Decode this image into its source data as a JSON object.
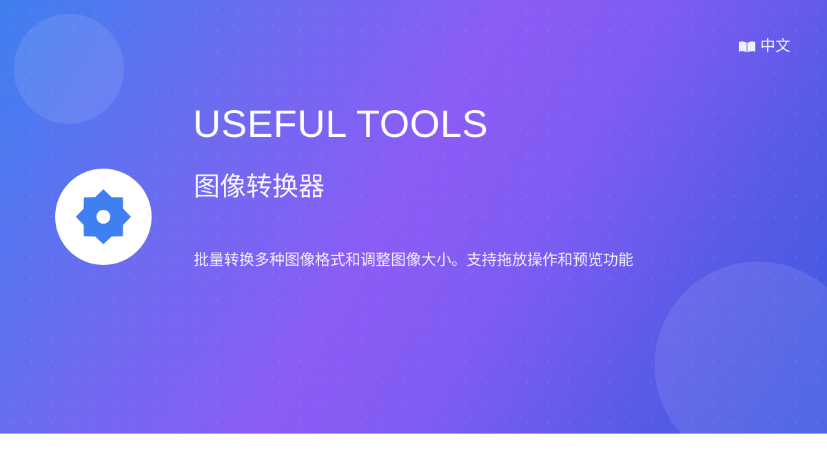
{
  "header": {
    "language_label": "中文",
    "language_icon": "book-icon"
  },
  "hero": {
    "title": "USEFUL TOOLS",
    "subtitle": "图像转换器",
    "description": "批量转换多种图像格式和调整图像大小。支持拖放操作和预览功能",
    "logo_icon": "settings-icon"
  },
  "colors": {
    "gradient_start": "#3f7ff0",
    "gradient_mid": "#8b5cf6",
    "gradient_end": "#3c58df",
    "icon_blue": "#3f7ff0"
  }
}
